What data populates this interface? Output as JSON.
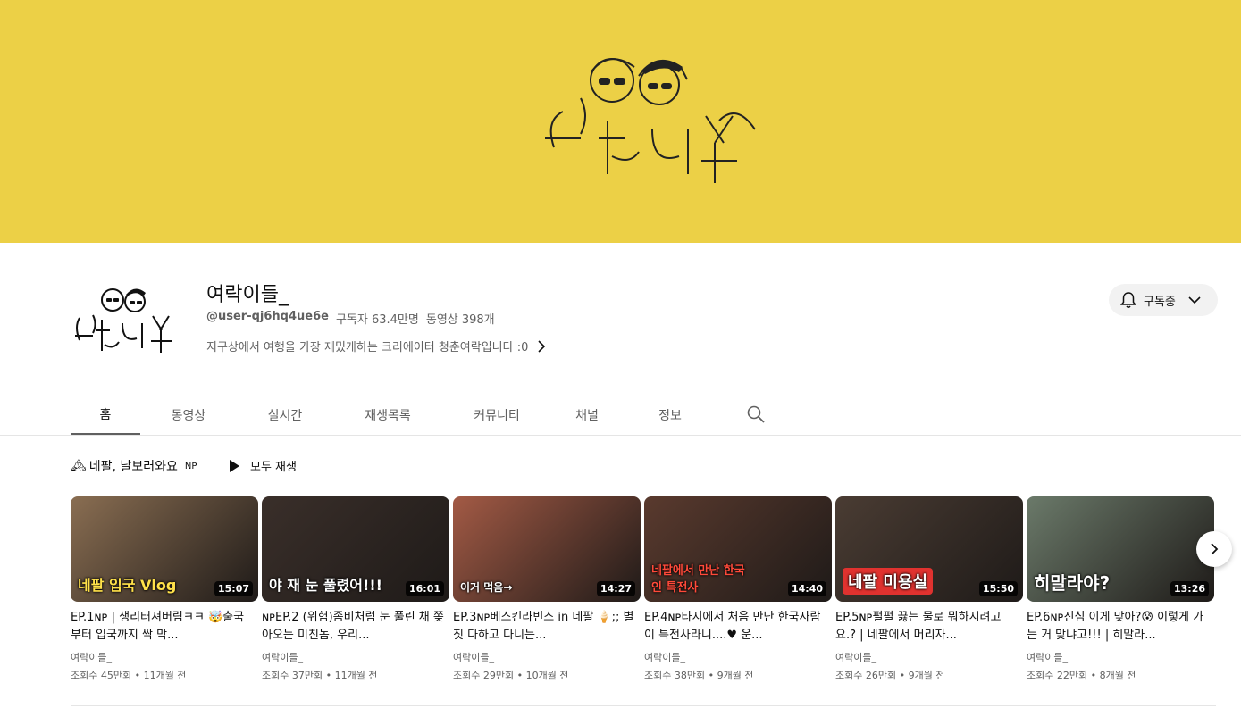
{
  "banner": {
    "bg_color": "#ecd046",
    "logo_text": "청춘여樂"
  },
  "channel": {
    "name": "여락이들_",
    "handle": "@user-qj6hq4ue6e",
    "subscribers": "구독자 63.4만명",
    "video_count": "동영상 398개",
    "description": "지구상에서 여행을 가장 재밌게하는 크리에이터 청춘여락입니다 :0",
    "subscribe_label": "구독중"
  },
  "tabs": [
    {
      "label": "홈"
    },
    {
      "label": "동영상"
    },
    {
      "label": "실시간"
    },
    {
      "label": "재생목록"
    },
    {
      "label": "커뮤니티"
    },
    {
      "label": "채널"
    },
    {
      "label": "정보"
    }
  ],
  "shelf": {
    "emoji": "🏔",
    "title": "네팔, 날보러와요",
    "title_suffix": "NP",
    "play_all": "모두 재생"
  },
  "videos": [
    {
      "caption": "네팔 입국 Vlog",
      "duration": "15:07",
      "title": "EP.1ɴᴘ | 생리터져버림ㅋㅋ 🤯출국부터 입국까지 싹 막...",
      "channel": "여락이들_",
      "stats": "조회수 45만회 • 11개월 전",
      "color": "#8a6e52"
    },
    {
      "caption": "야 재 눈 풀렸어!!!",
      "duration": "16:01",
      "title": "ɴᴘEP.2 (위험)좀비처럼 눈 풀린 채 쫒아오는 미친놈, 우리...",
      "channel": "여락이들_",
      "stats": "조회수 37만회 • 11개월 전",
      "color": "#3a2f2a"
    },
    {
      "caption": "이거 먹음→",
      "duration": "14:27",
      "title": "EP.3ɴᴘ베스킨라빈스 in 네팔 🍦;; 별짓 다하고 다니는...",
      "channel": "여락이들_",
      "stats": "조회수 29만회 • 10개월 전",
      "color": "#a35a45"
    },
    {
      "caption": "네팔에서 만난 한국인 특전사",
      "duration": "14:40",
      "title": "EP.4ɴᴘ타지에서 처음 만난 한국사람이 특전사라니....♥ 운...",
      "channel": "여락이들_",
      "stats": "조회수 38만회 • 9개월 전",
      "color": "#5a3a2e"
    },
    {
      "caption": "네팔 미용실",
      "duration": "15:50",
      "title": "EP.5ɴᴘ펄펄 끓는 물로 뭐하시려고요.? | 네팔에서 머리자...",
      "channel": "여락이들_",
      "stats": "조회수 26만회 • 9개월 전",
      "color": "#4a3c33"
    },
    {
      "caption": "히말라야?",
      "duration": "13:26",
      "title": "EP.6ɴᴘ진심 이게 맞아?😰 이렇게 가는 거 맞냐고!!! | 히말라...",
      "channel": "여락이들_",
      "stats": "조회수 22만회 • 8개월 전",
      "color": "#6b7a6a"
    }
  ]
}
